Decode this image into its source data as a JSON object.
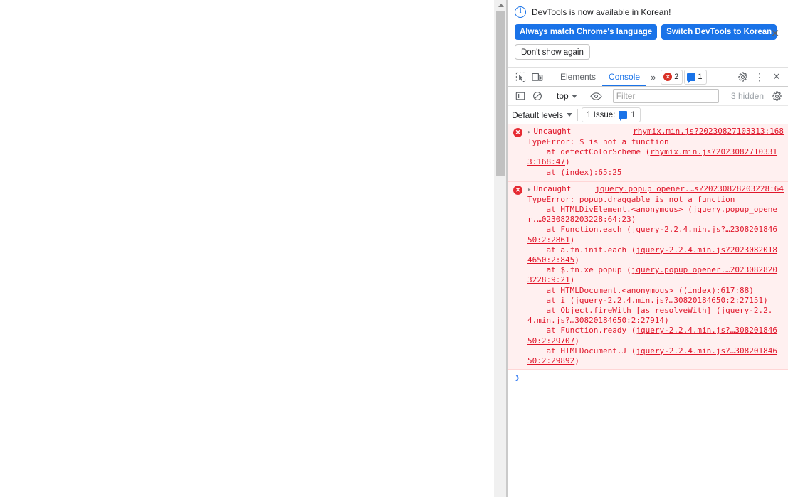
{
  "window": {
    "page_background": "#ffffff",
    "accent": "#1a73e8",
    "error_color": "#e0172b",
    "error_background": "#fff0f0"
  },
  "page_scrollbar": {
    "up_arrow_icon": "scroll-up-arrow-icon",
    "thumb_position_pct": 2,
    "thumb_size_pct": 33
  },
  "infobar": {
    "icon": "info-circle-icon",
    "message": "DevTools is now available in Korean!",
    "primary_button": "Always match Chrome's language",
    "secondary_button": "Switch DevTools to Korean",
    "dismiss_button": "Don't show again",
    "close_icon": "close-icon",
    "close_glyph": "✕"
  },
  "tabbar": {
    "inspect_icon": "inspect-element-icon",
    "device_toolbar_icon": "device-toolbar-icon",
    "tabs": [
      {
        "label": "Elements",
        "active": false
      },
      {
        "label": "Console",
        "active": true
      }
    ],
    "more_tabs_icon": "more-tabs-chevron-icon",
    "more_tabs_glyph": "»",
    "error_count": "2",
    "message_count": "1",
    "settings_icon": "gear-icon",
    "more_options_icon": "kebab-menu-icon",
    "more_options_glyph": "⋮",
    "close_devtools_icon": "close-icon",
    "close_devtools_glyph": "✕"
  },
  "filterbar": {
    "sidebar_toggle_icon": "console-sidebar-toggle-icon",
    "clear_console_icon": "clear-console-icon",
    "context_selector": "top",
    "context_caret_icon": "chevron-down-icon",
    "live_expression_icon": "eye-icon",
    "filter_placeholder": "Filter",
    "filter_value": "",
    "hidden_label": "3 hidden",
    "filter_settings_icon": "gear-icon"
  },
  "levelsbar": {
    "levels_label": "Default levels",
    "levels_caret_icon": "chevron-down-icon",
    "issues_label": "1 Issue:",
    "issues_count": "1",
    "issues_icon": "issue-message-icon"
  },
  "console_messages": [
    {
      "type": "error",
      "icon": "error-circle-icon",
      "disclosure_glyph": "▸",
      "title": "Uncaught",
      "origin": "rhymix.min.js?20230827103313:168",
      "stack": [
        {
          "text": "TypeError: $ is not a function",
          "indent": 0
        },
        {
          "text": "    at detectColorScheme (",
          "link": "rhymix.min.js?2023082710331\n3:168:47",
          "suffix": ")",
          "indent": 1
        },
        {
          "text": "    at ",
          "link": "(index):65:25",
          "suffix": "",
          "indent": 1
        }
      ]
    },
    {
      "type": "error",
      "icon": "error-circle-icon",
      "disclosure_glyph": "▸",
      "title": "Uncaught",
      "origin": "jquery.popup_opener.…s?20230828203228:64",
      "stack": [
        {
          "text": "TypeError: popup.draggable is not a function",
          "indent": 0
        },
        {
          "text": "    at HTMLDivElement.<anonymous> (",
          "link": "jquery.popup_opene\nr.…0230828203228:64:23",
          "suffix": ")",
          "indent": 1
        },
        {
          "text": "    at Function.each (",
          "link": "jquery-2.2.4.min.js?…2308201846\n50:2:2861",
          "suffix": ")",
          "indent": 1
        },
        {
          "text": "    at a.fn.init.each (",
          "link": "jquery-2.2.4.min.js?2023082018\n4650:2:845",
          "suffix": ")",
          "indent": 1
        },
        {
          "text": "    at $.fn.xe_popup (",
          "link": "jquery.popup_opener.…2023082820\n3228:9:21",
          "suffix": ")",
          "indent": 1
        },
        {
          "text": "    at HTMLDocument.<anonymous> (",
          "link": "(index):617:88",
          "suffix": ")",
          "indent": 1
        },
        {
          "text": "    at i (",
          "link": "jquery-2.2.4.min.js?…30820184650:2:27151",
          "suffix": ")",
          "indent": 1
        },
        {
          "text": "    at Object.fireWith [as resolveWith] (",
          "link": "jquery-2.2.\n4.min.js?…30820184650:2:27914",
          "suffix": ")",
          "indent": 1
        },
        {
          "text": "    at Function.ready (",
          "link": "jquery-2.2.4.min.js?…308201846\n50:2:29707",
          "suffix": ")",
          "indent": 1
        },
        {
          "text": "    at HTMLDocument.J (",
          "link": "jquery-2.2.4.min.js?…308201846\n50:2:29892",
          "suffix": ")",
          "indent": 1
        }
      ]
    }
  ],
  "prompt": {
    "arrow_glyph": "❯",
    "value": ""
  }
}
